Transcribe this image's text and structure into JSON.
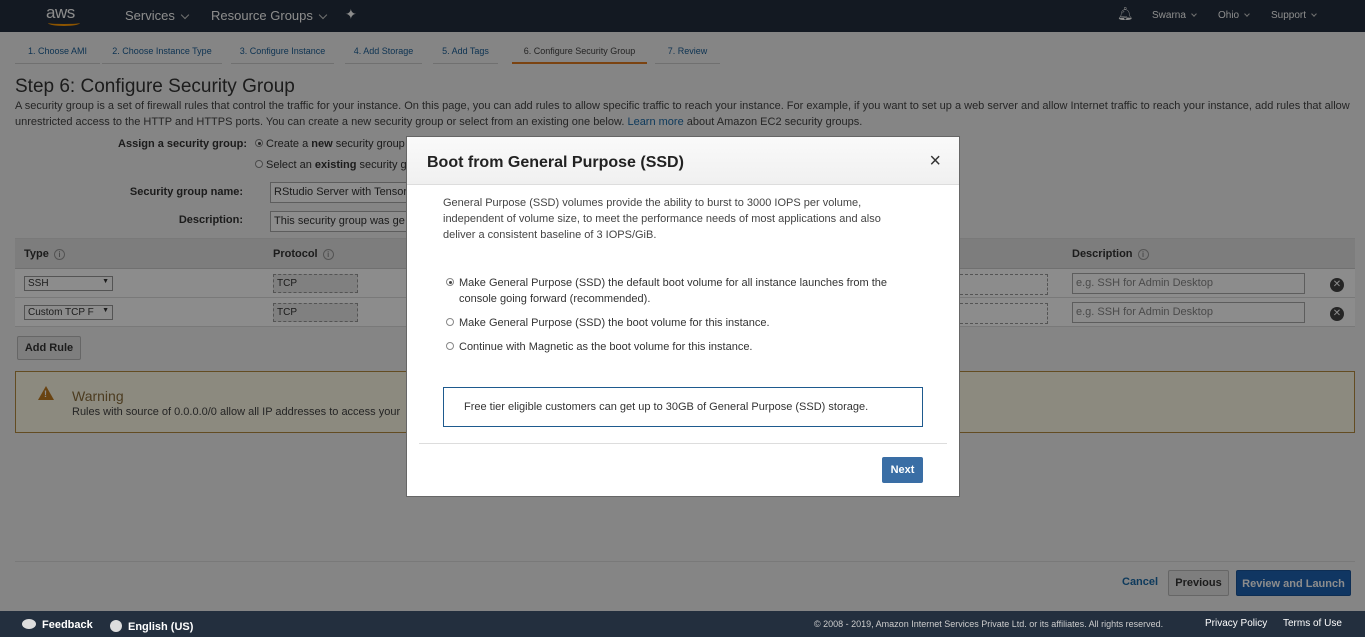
{
  "topnav": {
    "logo": "aws",
    "services": "Services",
    "resource_groups": "Resource Groups",
    "user": "Swarna",
    "region": "Ohio",
    "support": "Support"
  },
  "wizard_tabs": [
    "1. Choose AMI",
    "2. Choose Instance Type",
    "3. Configure Instance",
    "4. Add Storage",
    "5. Add Tags",
    "6. Configure Security Group",
    "7. Review"
  ],
  "page": {
    "title": "Step 6: Configure Security Group",
    "intro_1": "A security group is a set of firewall rules that control the traffic for your instance. On this page, you can add rules to allow specific traffic to reach your instance. For example, if you want to set up a web server and allow Internet traffic to reach your instance, add rules that allow unrestricted access to the HTTP and HTTPS ports. You can create a new security group or select from an existing one below.",
    "learn_more": "Learn more",
    "intro_2": "about Amazon EC2 security groups."
  },
  "form": {
    "assign_label": "Assign a security group:",
    "create_prefix": "Create a ",
    "create_bold": "new",
    "create_suffix": " security group",
    "select_prefix": "Select an ",
    "select_bold": "existing",
    "select_suffix": " security gr",
    "name_label": "Security group name:",
    "name_value": "RStudio Server with Tensor",
    "desc_label": "Description:",
    "desc_value": "This security group was ge"
  },
  "table": {
    "col_type": "Type",
    "col_protocol": "Protocol",
    "col_description": "Description",
    "rows": [
      {
        "type": "SSH",
        "protocol": "TCP",
        "desc_placeholder": "e.g. SSH for Admin Desktop"
      },
      {
        "type": "Custom TCP F",
        "protocol": "TCP",
        "desc_placeholder": "e.g. SSH for Admin Desktop"
      }
    ],
    "add_rule": "Add Rule"
  },
  "warning": {
    "title": "Warning",
    "text": "Rules with source of 0.0.0.0/0 allow all IP addresses to access your"
  },
  "actions": {
    "cancel": "Cancel",
    "previous": "Previous",
    "review_launch": "Review and Launch"
  },
  "footer": {
    "feedback": "Feedback",
    "language": "English (US)",
    "copyright": "© 2008 - 2019, Amazon Internet Services Private Ltd. or its affiliates. All rights reserved.",
    "privacy": "Privacy Policy",
    "terms": "Terms of Use"
  },
  "modal": {
    "title": "Boot from General Purpose (SSD)",
    "close": "×",
    "paragraph": "General Purpose (SSD) volumes provide the ability to burst to 3000 IOPS per volume, independent of volume size, to meet the performance needs of most applications and also deliver a consistent baseline of 3 IOPS/GiB.",
    "options": [
      "Make General Purpose (SSD) the default boot volume for all instance launches from the console going forward (recommended).",
      "Make General Purpose (SSD) the boot volume for this instance.",
      "Continue with Magnetic as the boot volume for this instance."
    ],
    "selected_option": 0,
    "info": "Free tier eligible customers can get up to 30GB of General Purpose (SSD) storage.",
    "next": "Next"
  }
}
